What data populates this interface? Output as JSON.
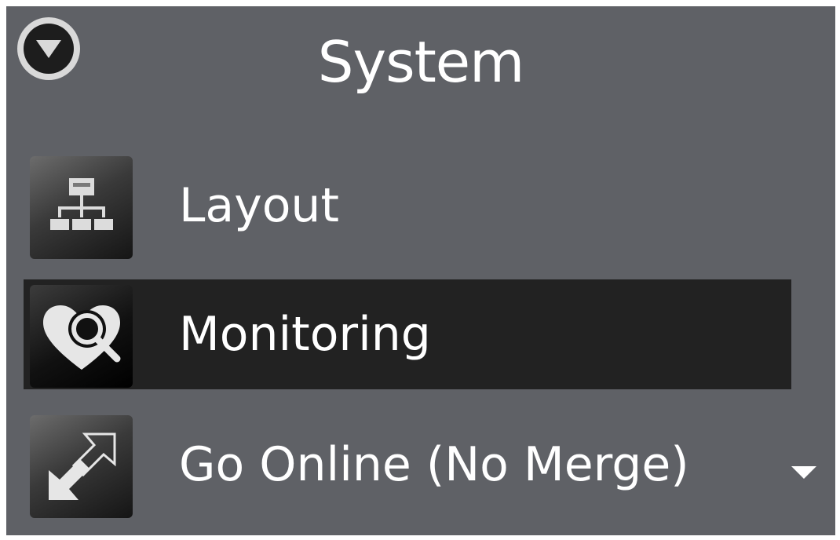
{
  "panel": {
    "title": "System",
    "background": "#5f6166",
    "collapse_icon": "triangle-down-icon"
  },
  "items": [
    {
      "label": "Layout",
      "icon": "network-layout-icon",
      "selected": false
    },
    {
      "label": "Monitoring",
      "icon": "heart-search-icon",
      "selected": true
    },
    {
      "label": "Go Online (No Merge)",
      "icon": "go-online-arrow-icon",
      "selected": false,
      "has_dropdown": true
    }
  ],
  "colors": {
    "selected_row": "#222222",
    "text": "#ffffff"
  }
}
